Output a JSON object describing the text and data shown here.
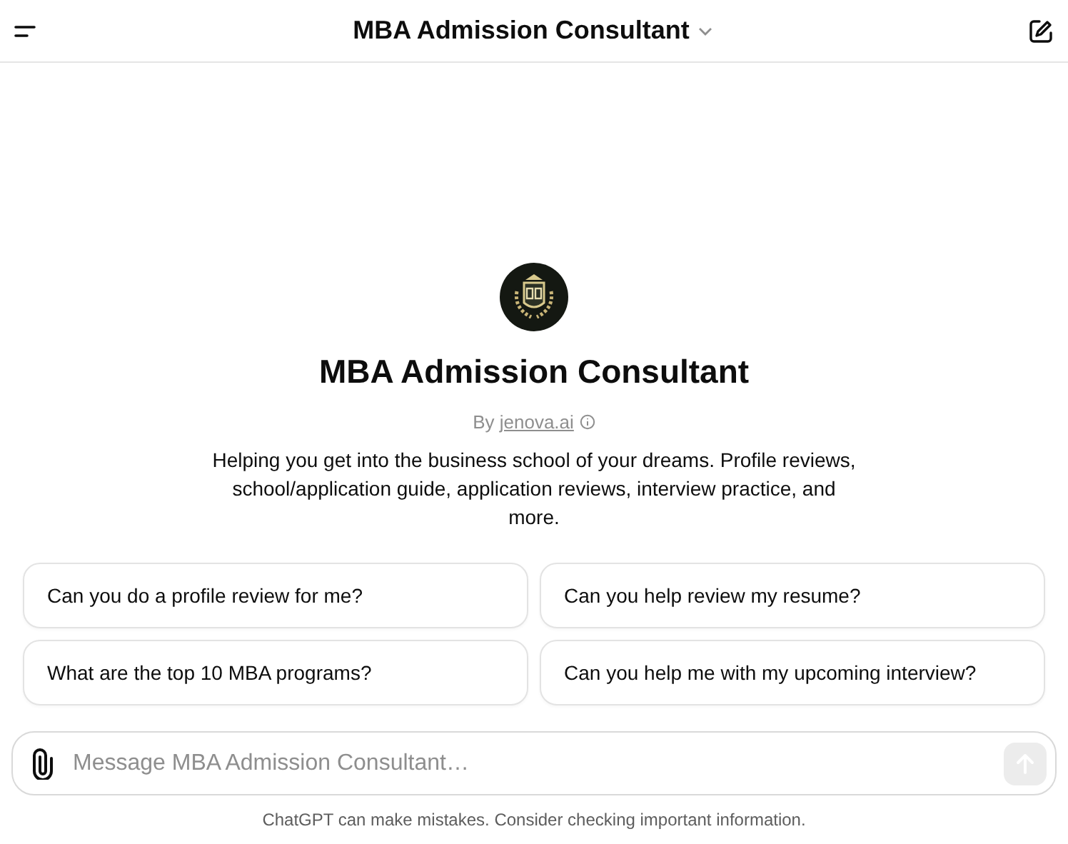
{
  "header": {
    "title": "MBA Admission Consultant"
  },
  "gpt": {
    "name": "MBA Admission Consultant",
    "by": "By",
    "author": "jenova.ai",
    "description": "Helping you get into the business school of your dreams. Profile reviews, school/application guide, application reviews, interview practice, and more."
  },
  "suggestions": [
    "Can you do a profile review for me?",
    "Can you help review my resume?",
    "What are the top 10 MBA programs?",
    "Can you help me with my upcoming interview?"
  ],
  "composer": {
    "placeholder": "Message MBA Admission Consultant…",
    "send_disabled": true
  },
  "footer": "ChatGPT can make mistakes. Consider checking important information."
}
